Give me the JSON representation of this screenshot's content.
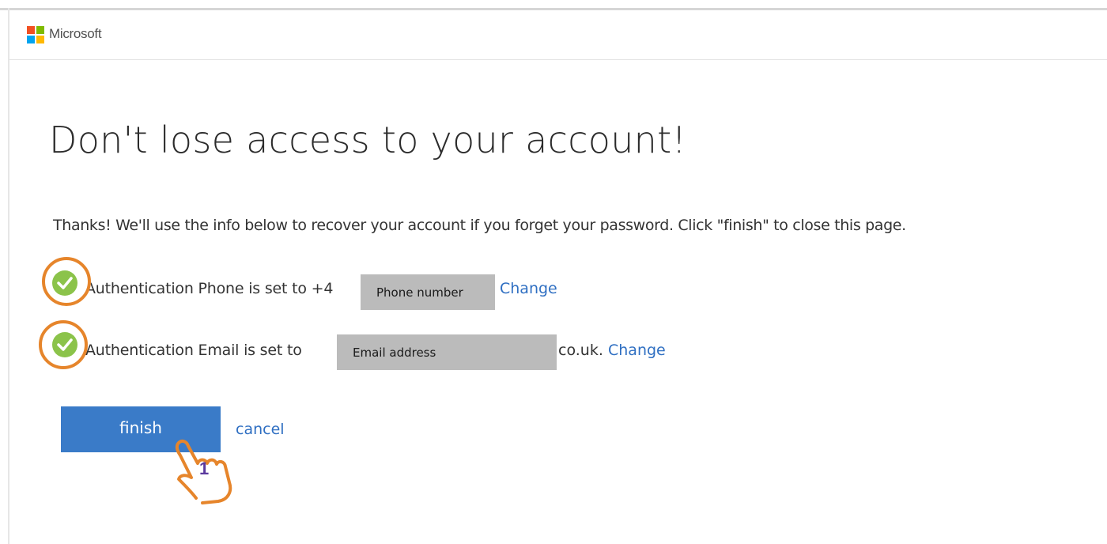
{
  "header": {
    "brand": "Microsoft",
    "logo_colors": [
      "#f25022",
      "#7fba00",
      "#00a4ef",
      "#ffb900"
    ]
  },
  "main": {
    "title": "Don't lose access to your account!",
    "intro": "Thanks! We'll use the info below to recover your account if you forget your password. Click \"finish\" to close this page.",
    "phone_row": {
      "prefix": "Authentication Phone is set to +4",
      "redaction_label": "Phone number",
      "change_label": "Change"
    },
    "email_row": {
      "prefix": "Authentication Email is set to",
      "redaction_label": "Email address",
      "suffix": "co.uk.",
      "change_label": "Change"
    }
  },
  "actions": {
    "finish_label": "finish",
    "cancel_label": "cancel"
  },
  "annotation": {
    "step_number": "1",
    "highlight_color": "#e6852b",
    "step_color": "#5b3a9e"
  },
  "colors": {
    "accent": "#3a7bc8",
    "link": "#2f6fc2",
    "check": "#8bc34a"
  }
}
